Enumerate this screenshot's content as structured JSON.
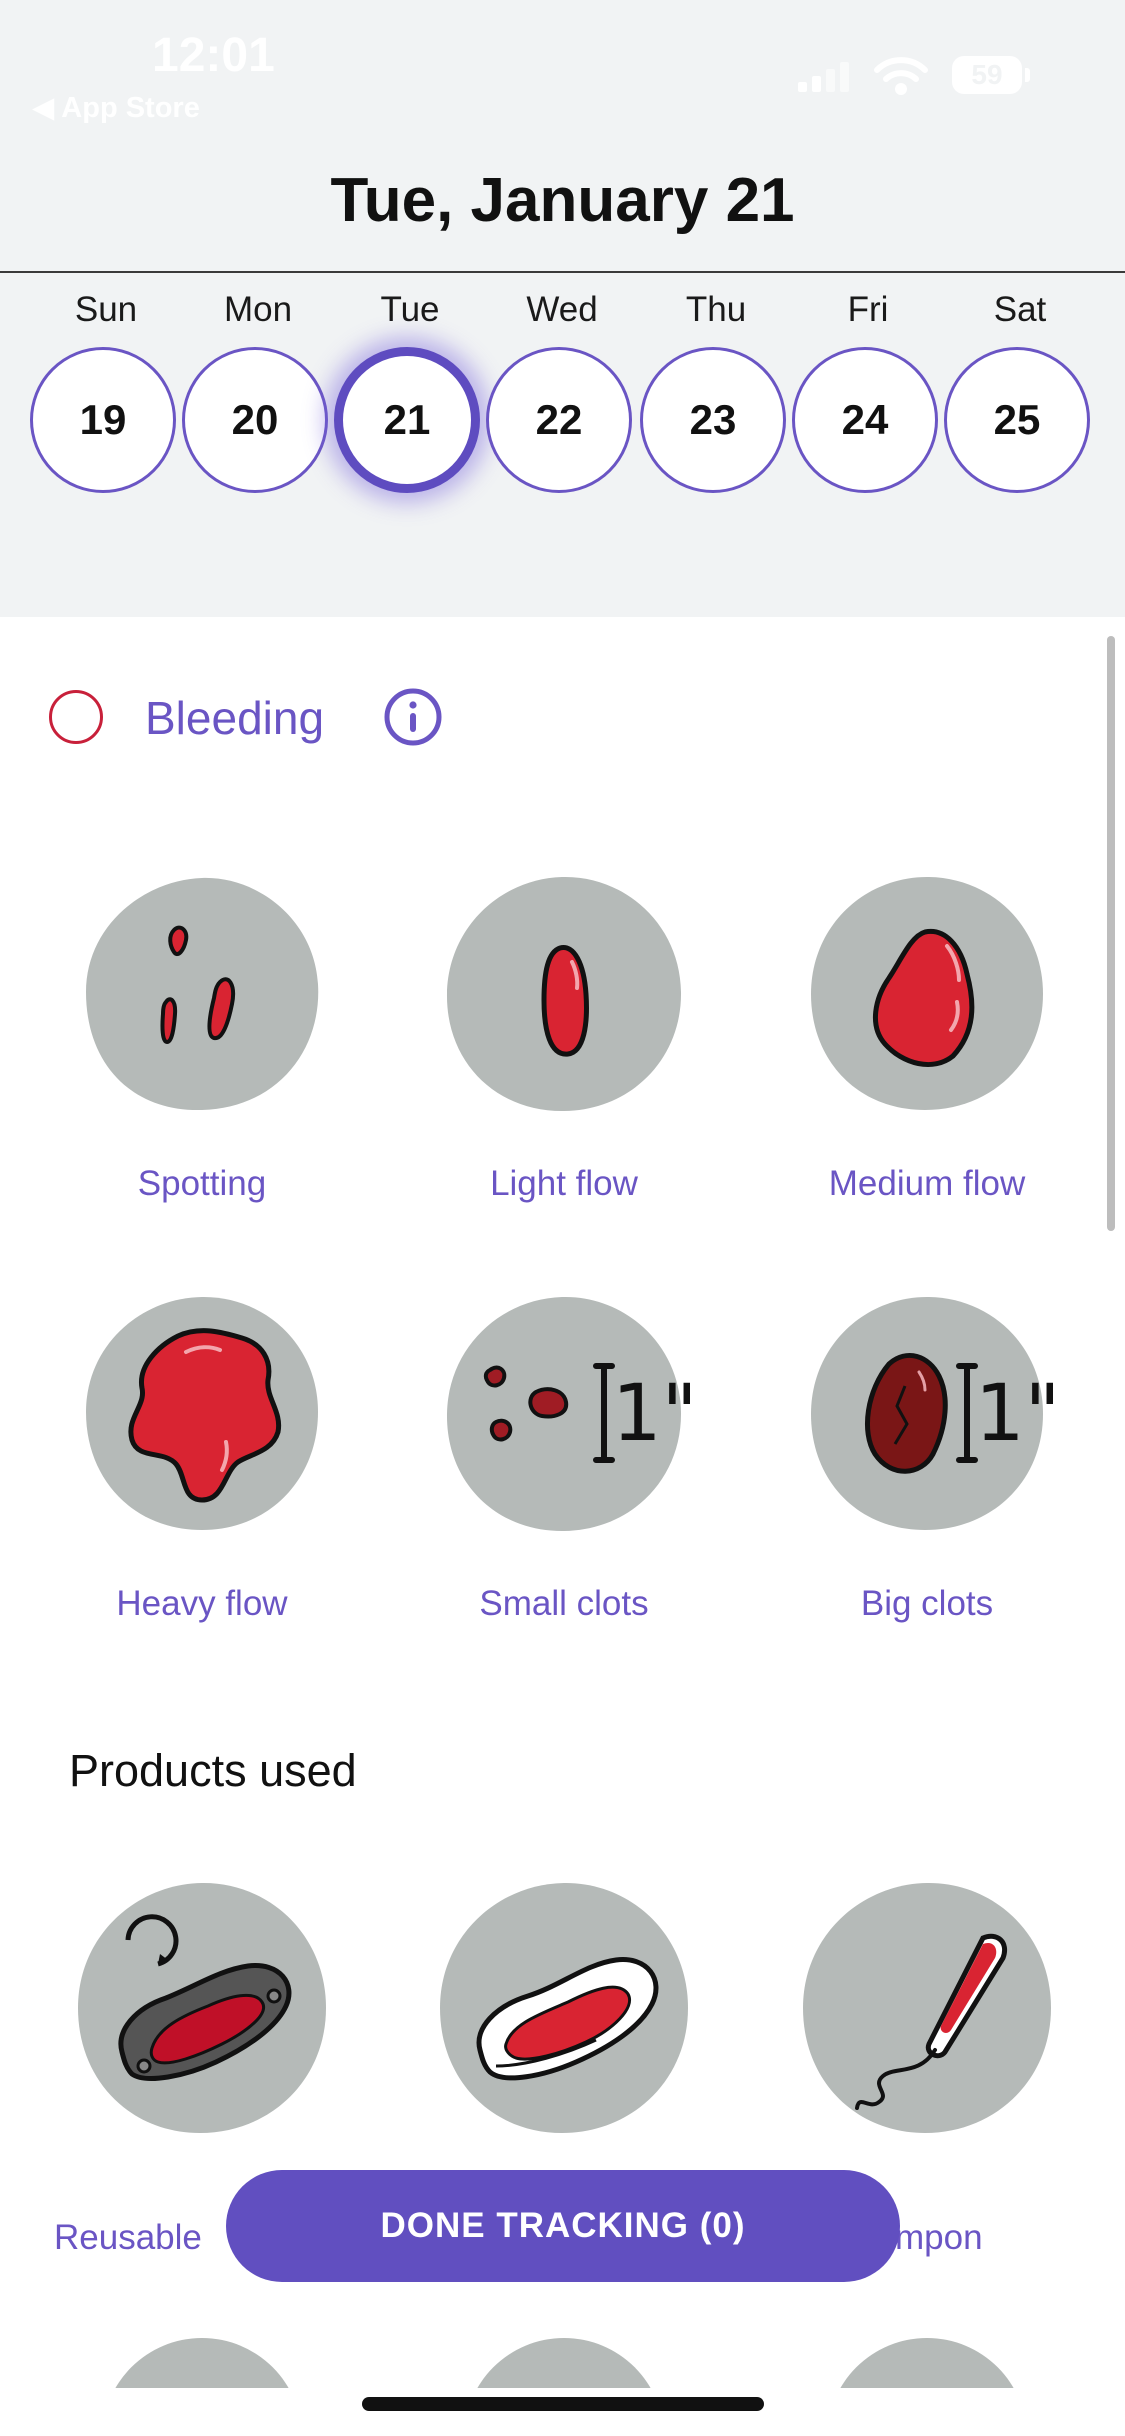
{
  "status_bar": {
    "time": "12:01",
    "back_label": "◀ App Store",
    "battery": "59"
  },
  "header": {
    "date_title": "Tue, January 21"
  },
  "week": [
    {
      "name": "Sun",
      "num": "19",
      "selected": false
    },
    {
      "name": "Mon",
      "num": "20",
      "selected": false
    },
    {
      "name": "Tue",
      "num": "21",
      "selected": true
    },
    {
      "name": "Wed",
      "num": "22",
      "selected": false
    },
    {
      "name": "Thu",
      "num": "23",
      "selected": false
    },
    {
      "name": "Fri",
      "num": "24",
      "selected": false
    },
    {
      "name": "Sat",
      "num": "25",
      "selected": false
    }
  ],
  "bleeding": {
    "label": "Bleeding",
    "options": [
      {
        "label": "Spotting"
      },
      {
        "label": "Light flow"
      },
      {
        "label": "Medium flow"
      },
      {
        "label": "Heavy flow"
      },
      {
        "label": "Small clots",
        "size_text": "1\""
      },
      {
        "label": "Big clots",
        "size_text": "1\""
      }
    ]
  },
  "products": {
    "title": "Products used",
    "options": [
      {
        "label": "Reusable"
      },
      {
        "label": ""
      },
      {
        "label": "mpon"
      }
    ]
  },
  "done_button": {
    "label": "DONE TRACKING (0)"
  },
  "colors": {
    "accent": "#614fc0",
    "blob": "#b5bab8",
    "blood": "#d92432",
    "dark_blood": "#7a1616",
    "header_bg": "#f1f3f4"
  }
}
